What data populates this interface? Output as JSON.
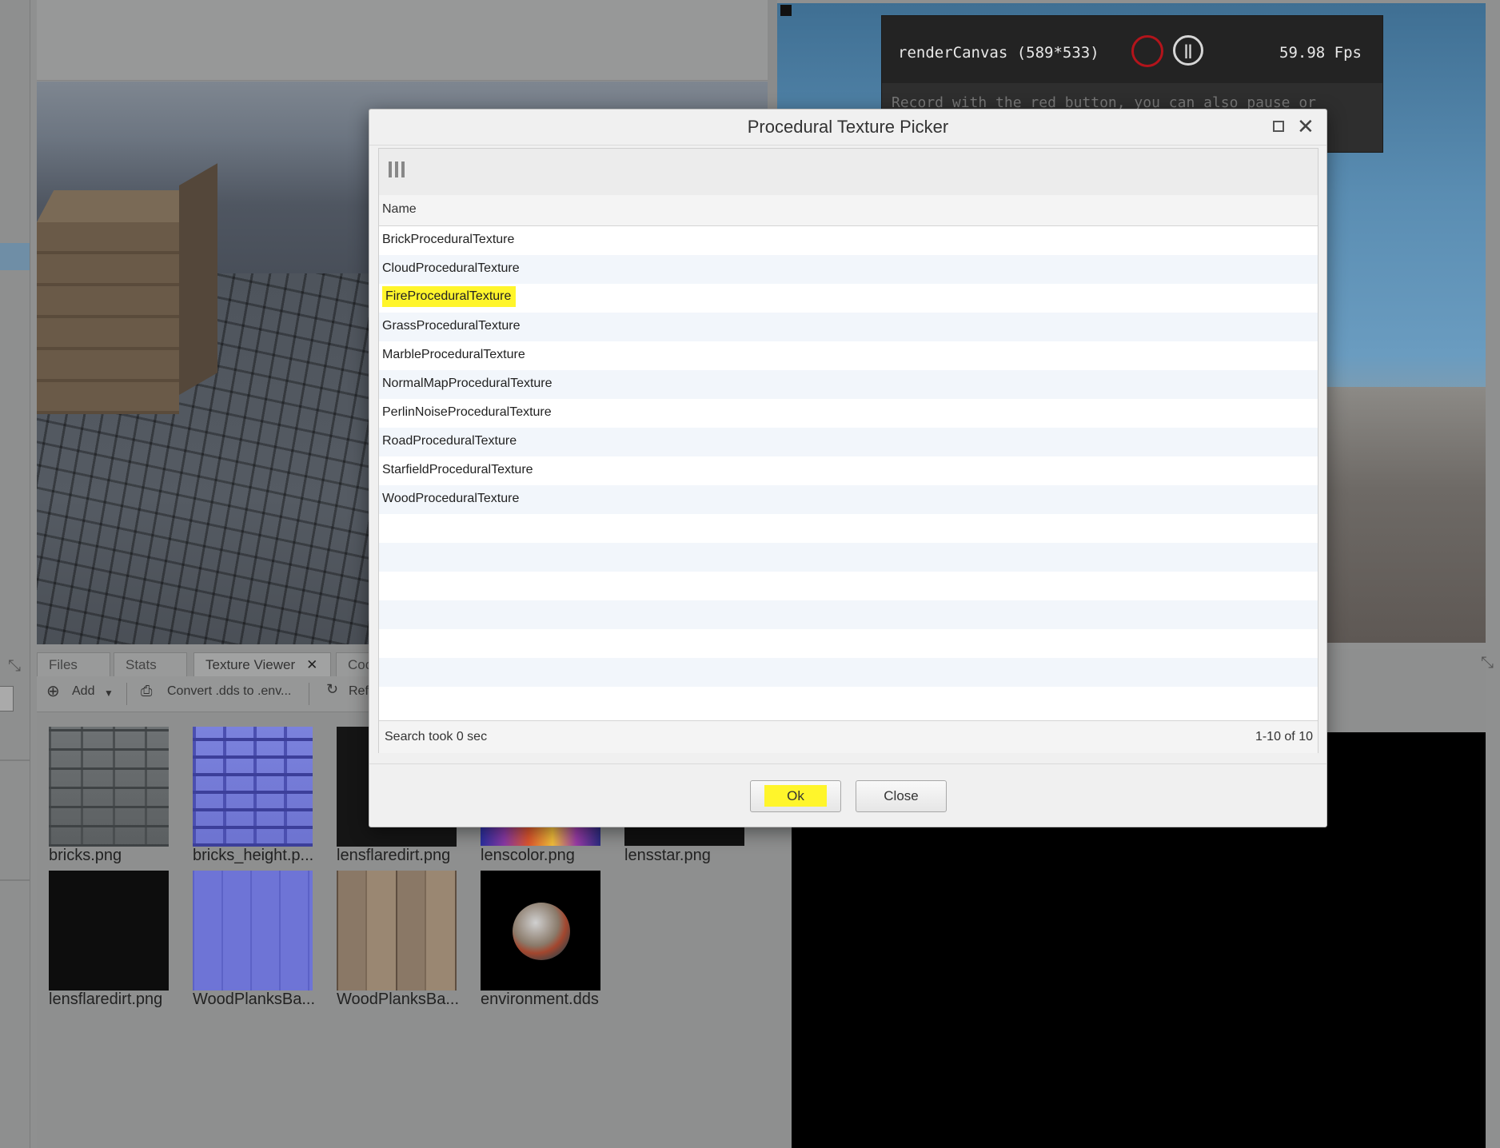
{
  "renderer": {
    "canvas_title": "renderCanvas (589*533)",
    "fps": "59.98 Fps",
    "hint": "Record with the red button, you can also pause or"
  },
  "bottom_tabs": [
    {
      "label": "Files"
    },
    {
      "label": "Stats"
    },
    {
      "label": "Texture Viewer"
    },
    {
      "label": "Coc"
    }
  ],
  "bottom_toolbar": {
    "add_label": "Add",
    "convert_label": "Convert .dds to .env...",
    "refresh_label": "Ref"
  },
  "textures": [
    {
      "name": "bricks.png"
    },
    {
      "name": "bricks_height.p..."
    },
    {
      "name": "lensflaredirt.png"
    },
    {
      "name": "lenscolor.png"
    },
    {
      "name": "lensstar.png"
    },
    {
      "name": "lensflaredirt.png"
    },
    {
      "name": "WoodPlanksBa..."
    },
    {
      "name": "WoodPlanksBa..."
    },
    {
      "name": "environment.dds"
    }
  ],
  "dialog": {
    "title": "Procedural Texture Picker",
    "column_header": "Name",
    "rows": [
      "BrickProceduralTexture",
      "CloudProceduralTexture",
      "FireProceduralTexture",
      "GrassProceduralTexture",
      "MarbleProceduralTexture",
      "NormalMapProceduralTexture",
      "PerlinNoiseProceduralTexture",
      "RoadProceduralTexture",
      "StarfieldProceduralTexture",
      "WoodProceduralTexture"
    ],
    "highlighted_row": "FireProceduralTexture",
    "search_time": "Search took 0 sec",
    "result_count": "1-10 of 10",
    "ok_label": "Ok",
    "close_label": "Close"
  },
  "colors": {
    "highlight": "#fff52b",
    "record": "#b3141b"
  }
}
